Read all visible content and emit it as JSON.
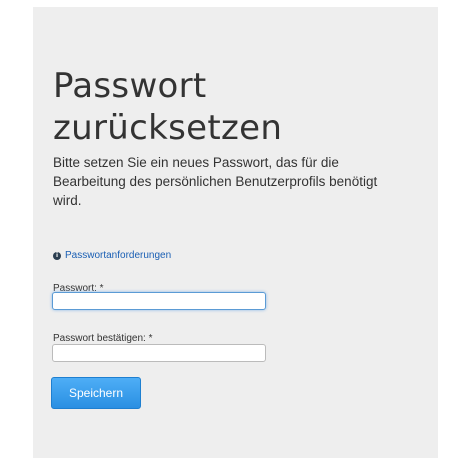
{
  "page": {
    "title_line1": "Passwort",
    "title_line2": "zurücksetzen",
    "description": "Bitte setzen Sie ein neues Passwort, das für die Bearbeitung des persönlichen Benutzerprofils benötigt wird."
  },
  "requirements": {
    "icon": "info-icon",
    "icon_glyph": "i",
    "label": "Passwortanforderungen"
  },
  "form": {
    "password_label": "Passwort: *",
    "password_value": "",
    "confirm_label": "Passwort bestätigen: *",
    "confirm_value": "",
    "save_label": "Speichern"
  },
  "colors": {
    "accent": "#2a8fe2",
    "link": "#1a5fb4",
    "panel_bg": "#eeeeee"
  }
}
